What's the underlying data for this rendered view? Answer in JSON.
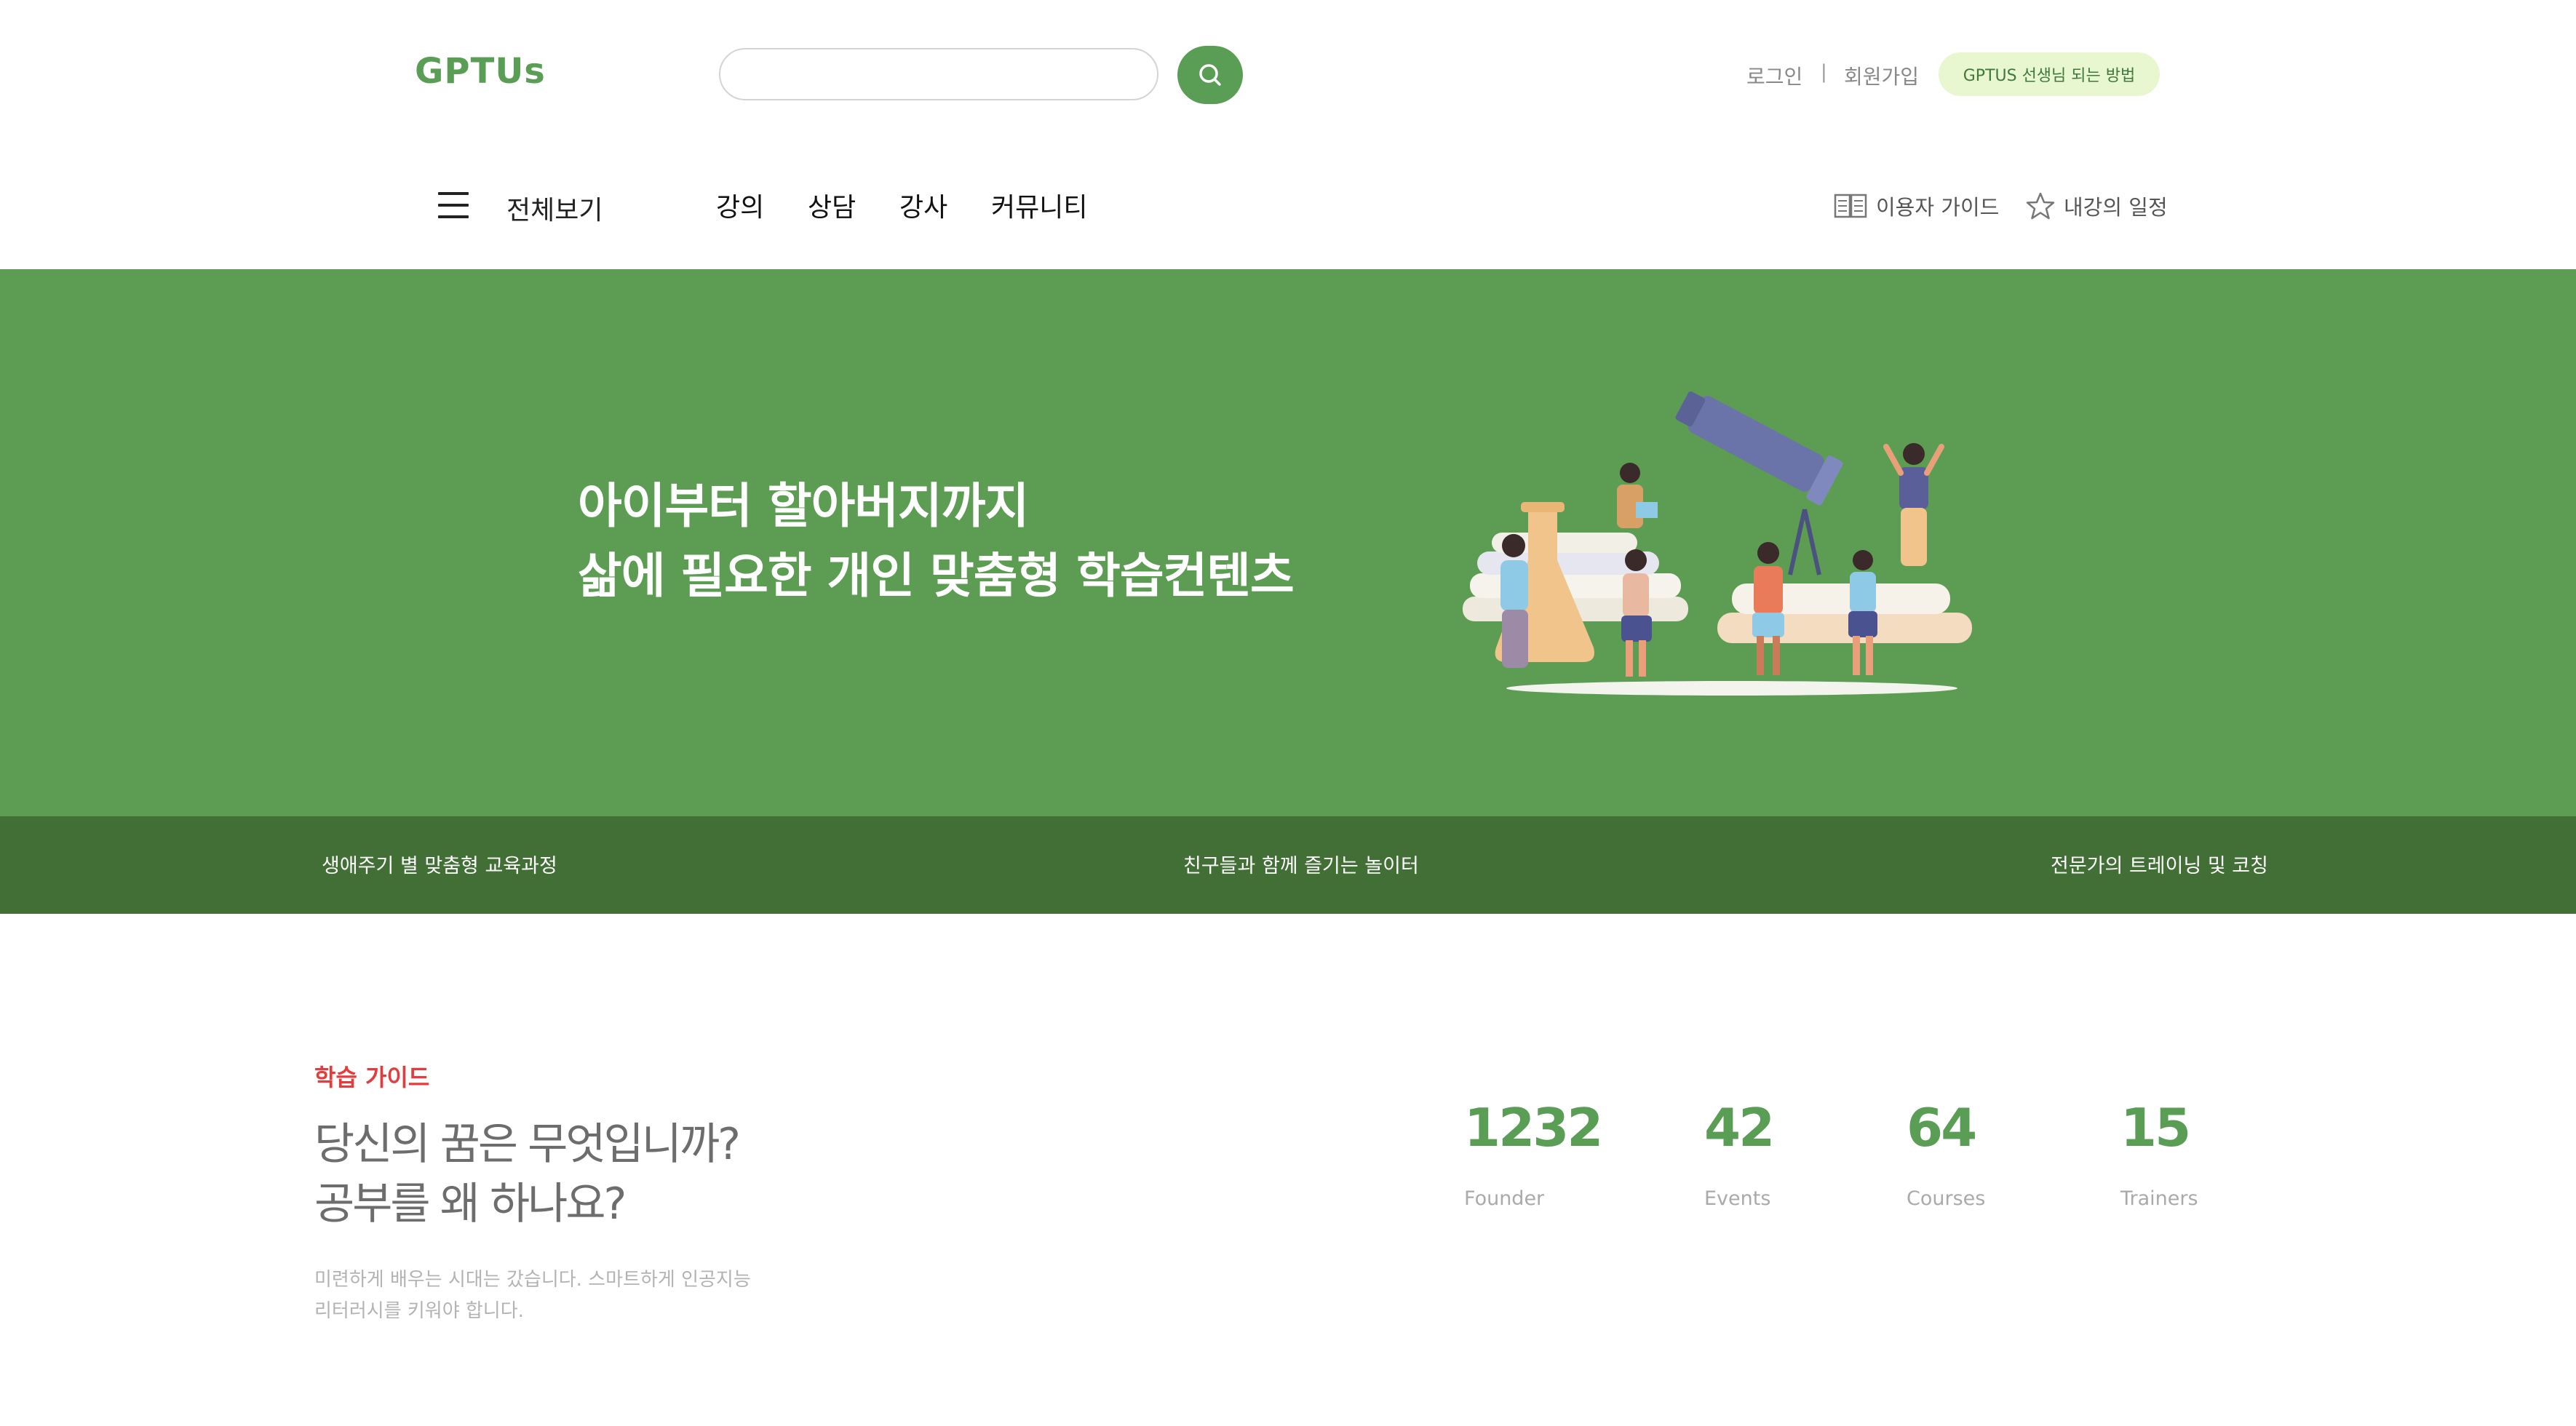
{
  "header": {
    "logo": "GPTUs",
    "search": {
      "value": "",
      "placeholder": ""
    },
    "login_label": "로그인",
    "separator": "|",
    "signup_label": "회원가입",
    "teacher_pill_label": "GPTUS 선생님 되는 방법"
  },
  "nav": {
    "all_view_label": "전체보기",
    "items": [
      {
        "label": "강의"
      },
      {
        "label": "상담"
      },
      {
        "label": "강사"
      },
      {
        "label": "커뮤니티"
      }
    ],
    "user_guide_label": "이용자 가이드",
    "my_schedule_label": "내강의 일정"
  },
  "hero": {
    "title_line1": "아이부터 할아버지까지",
    "title_line2": "삶에 필요한 개인 맞춤형 학습컨텐츠",
    "bg_color": "#5c9d53"
  },
  "band": {
    "bg_color": "#426f36",
    "items": [
      {
        "label": "생애주기 별 맞춤형 교육과정"
      },
      {
        "label": "친구들과 함께 즐기는 놀이터"
      },
      {
        "label": "전문가의 트레이닝 및 코칭"
      }
    ]
  },
  "guide": {
    "kicker": "학습 가이드",
    "headline_line1": "당신의 꿈은 무엇입니까?",
    "headline_line2": "공부를 왜 하나요?",
    "desc_line1": "미련하게 배우는 시대는 갔습니다. 스마트하게 인공지능",
    "desc_line2": "리터러시를 키워야 합니다."
  },
  "stats": [
    {
      "value": "1232",
      "label": "Founder"
    },
    {
      "value": "42",
      "label": "Events"
    },
    {
      "value": "64",
      "label": "Courses"
    },
    {
      "value": "15",
      "label": "Trainers"
    }
  ],
  "colors": {
    "brand_green": "#5a9d55",
    "accent_red": "#e23d3d",
    "pill_bg": "#e8f7cf"
  },
  "icons": [
    "search-icon",
    "hamburger-menu-icon",
    "book-icon",
    "star-icon"
  ]
}
